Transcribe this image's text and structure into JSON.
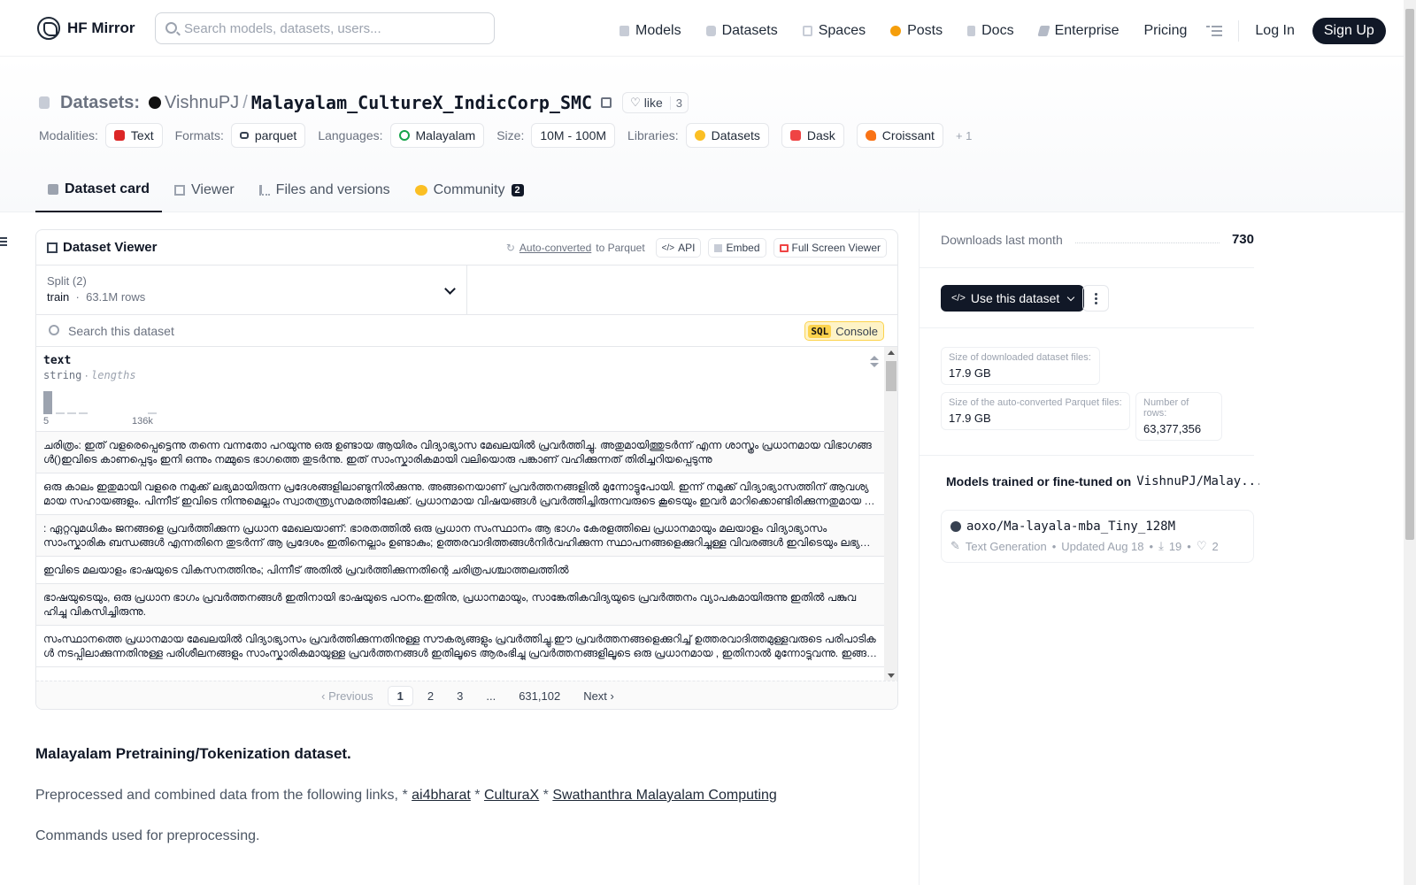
{
  "header": {
    "brand": "HF Mirror",
    "search_placeholder": "Search models, datasets, users...",
    "nav": [
      {
        "label": "Models",
        "icon": "cube-icon"
      },
      {
        "label": "Datasets",
        "icon": "database-icon"
      },
      {
        "label": "Spaces",
        "icon": "grid-icon"
      },
      {
        "label": "Posts",
        "icon": "posts-icon"
      },
      {
        "label": "Docs",
        "icon": "docs-icon"
      },
      {
        "label": "Enterprise",
        "icon": "enterprise-icon"
      },
      {
        "label": "Pricing"
      }
    ],
    "login": "Log In",
    "signup": "Sign Up"
  },
  "repo": {
    "kind": "Datasets:",
    "owner": "VishnuPJ",
    "name": "Malayalam_CultureX_IndicCorp_SMC",
    "like_label": "like",
    "like_count": "3"
  },
  "tags": {
    "modalities_label": "Modalities:",
    "modality": "Text",
    "formats_label": "Formats:",
    "format": "parquet",
    "languages_label": "Languages:",
    "language": "Malayalam",
    "size_label": "Size:",
    "size": "10M - 100M",
    "libraries_label": "Libraries:",
    "libraries": [
      "Datasets",
      "Dask",
      "Croissant"
    ],
    "more": "+ 1"
  },
  "tabs": [
    {
      "label": "Dataset card"
    },
    {
      "label": "Viewer"
    },
    {
      "label": "Files and versions"
    },
    {
      "label": "Community",
      "badge": "2"
    }
  ],
  "viewer": {
    "title": "Dataset Viewer",
    "auto_converted": "Auto-converted",
    "to_parquet": "to Parquet",
    "api": "API",
    "embed": "Embed",
    "full_screen": "Full Screen Viewer",
    "split_label": "Split (2)",
    "split_value": "train",
    "split_rows": "63.1M rows",
    "search_placeholder": "Search this dataset",
    "sql": "SQL",
    "console": "Console",
    "column": {
      "name": "text",
      "type": "string",
      "note": "lengths",
      "min": "5",
      "max": "136k"
    },
    "rows": [
      "ചരിത്രം: ഇത് വളരെപ്പെട്ടെന്നു തന്നെ വന്നതോ പറയുന്നു ഒരു ഉണ്ടായ ആയിരം വിദ്യാഭ്യാസ മേഖലയിൽ പ്രവർത്തിച്ചു. അതുമായിത്തുടർന്ന് എന്ന ശാസ്ത്രം പ്രധാനമായ വിഭാഗങ്ങൾ()ഇവിടെ കാണപ്പെടും ഇനി ഒന്നും നമ്മുടെ ഭാഗത്തെ തുടർന്നു. ഇത് സാംസ്കാരികമായി വലിയൊരു പങ്കാണ് വഹിക്കുന്നത് തിരിച്ചറിയപ്പെടുന്നു",
      "ഒരു കാലം ഇതുമായി വളരെ നമുക്ക് ലഭ്യമായിരുന്ന പ്രദേശങ്ങളിലാണ്ടുനിൽക്കുന്നു. അങ്ങനെയാണ് പ്രവർത്തനങ്ങളിൽ മുന്നോട്ടുപോയി. ഇന്ന് നമുക്ക് വിദ്യാഭ്യാസത്തിന് ആവശ്യമായ സഹായങ്ങളും. പിന്നീട് ഇവിടെ നിന്നുമെല്ലാം സ്വാതന്ത്ര്യസമരത്തിലേക്ക്. പ്രധാനമായ വിഷയങ്ങൾ പ്രവർത്തിച്ചിരുന്നവരുടെ കൂടെയും ഇവർ മാറിക്കൊണ്ടിരിക്കുന്നതുമായ ബന്ധങ്ങൾ",
      ": ഏറ്റവുമധികം ജനങ്ങളെ പ്രവർത്തിക്കുന്ന പ്രധാന മേഖലയാണ്: ഭാരതത്തിൽ ഒരു പ്രധാന സംസ്ഥാനം ആ ഭാഗം കേരളത്തിലെ പ്രധാനമായും മലയാളം വിദ്യാഭ്യാസം സാംസ്കാരിക ബന്ധങ്ങൾ എന്നതിനെ തുടർന്ന് ആ പ്രദേശം ഇതിനെല്ലാം ഉണ്ടാകും; ഉത്തരവാദിത്തങ്ങൾനിർവഹിക്കുന്ന സ്ഥാപനങ്ങളെക്കുറിച്ചുള്ള വിവരങ്ങൾ ഇവിടെയും ലഭ്യമാണ് ഇതിന് തിരിച്ചറിയപ്പെടുന്നതിനായി ആ പ്രധാനമന്ത്രിയുടെ",
      "ഇവിടെ മലയാളം ഭാഷയുടെ വികസനത്തിനും; പിന്നീട് അതിൽ പ്രവർത്തിക്കുന്നതിന്റെ ചരിത്രപശ്ചാത്തലത്തിൽ",
      "ഭാഷയുടെയും, ഒരു പ്രധാന ഭാഗം പ്രവർത്തനങ്ങൾ ഇതിനായി ഭാഷയുടെ പഠനം.ഇതിനു, പ്രധാനമായും, സാങ്കേതികവിദ്യയുടെ പ്രവർത്തനം വ്യാപകമായിരുന്നു ഇതിൽ പങ്കുവഹിച്ചു വികസിച്ചിരുന്നു.",
      "സംസ്ഥാനത്തെ പ്രധാനമായ മേഖലയിൽ വിദ്യാഭ്യാസം പ്രവർത്തിക്കുന്നതിനുള്ള സൗകര്യങ്ങളും പ്രവർത്തിച്ചു.ഈ പ്രവർത്തനങ്ങളെക്കുറിച്ച് ഉത്തരവാദിത്തമുള്ളവരുടെ പരിപാടികൾ നടപ്പിലാക്കുന്നതിനുള്ള പരിശീലനങ്ങളും സാംസ്കാരികമായുള്ള പ്രവർത്തനങ്ങൾ ഇതിലൂടെ ആരംഭിച്ചു പ്രവർത്തനങ്ങളിലൂടെ ഒരു പ്രധാനമായ , ഇതിനാൽ മുന്നോട്ടുവന്നു. ഇങ്ങനെ ഇതിനും . പ്രവർത്തിച്ചു"
    ],
    "pager": {
      "prev": "Previous",
      "pages": [
        "1",
        "2",
        "3"
      ],
      "ellipsis": "...",
      "last": "631,102",
      "next": "Next"
    }
  },
  "card": {
    "heading": "Malayalam Pretraining/Tokenization dataset.",
    "intro": "Preprocessed and combined data from the following links, *",
    "links": [
      "ai4bharat",
      "CulturaX",
      "Swathanthra Malayalam Computing"
    ],
    "commands": "Commands used for preprocessing."
  },
  "sidebar": {
    "downloads_label": "Downloads last month",
    "downloads_value": "730",
    "use_button": "Use this dataset",
    "stats": [
      {
        "label": "Size of downloaded dataset files:",
        "value": "17.9 GB"
      },
      {
        "label": "Size of the auto-converted Parquet files:",
        "value": "17.9 GB"
      },
      {
        "label": "Number of rows:",
        "value": "63,377,356"
      }
    ],
    "models_title": "Models trained or fine-tuned on",
    "models_repo": "VishnuPJ/Malay...",
    "model": {
      "name": "aoxo/Ma-layala-mba_Tiny_128M",
      "task": "Text Generation",
      "updated": "Updated Aug 18",
      "downloads": "19",
      "likes": "2"
    }
  }
}
